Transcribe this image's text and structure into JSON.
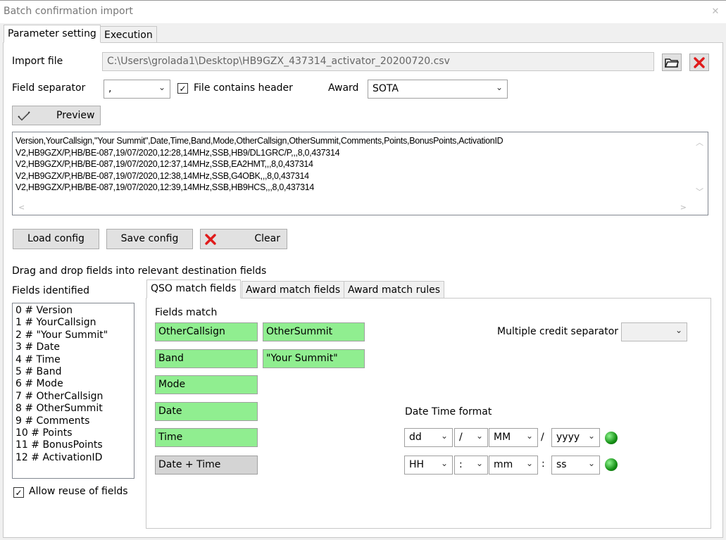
{
  "window": {
    "title": "Batch confirmation import",
    "close": "✕"
  },
  "tabs": [
    "Parameter setting",
    "Execution"
  ],
  "import_file": {
    "label": "Import file",
    "value": "C:\\Users\\grolada1\\Desktop\\HB9GZX_437314_activator_20200720.csv"
  },
  "field_separator": {
    "label": "Field separator",
    "value": ","
  },
  "header_checkbox": {
    "label": "File contains header",
    "checked": true
  },
  "award": {
    "label": "Award",
    "value": "SOTA"
  },
  "preview_button": {
    "label": "Preview"
  },
  "preview_lines": [
    "Version,YourCallsign,\"Your Summit\",Date,Time,Band,Mode,OtherCallsign,OtherSummit,Comments,Points,BonusPoints,ActivationID",
    "V2,HB9GZX/P,HB/BE-087,19/07/2020,12:28,14MHz,SSB,HB9/DL1GRC/P,,,8,0,437314",
    "V2,HB9GZX/P,HB/BE-087,19/07/2020,12:37,14MHz,SSB,EA2HMT,,,8,0,437314",
    "V2,HB9GZX/P,HB/BE-087,19/07/2020,12:38,14MHz,SSB,G4OBK,,,8,0,437314",
    "V2,HB9GZX/P,HB/BE-087,19/07/2020,12:39,14MHz,SSB,HB9HCS,,,8,0,437314"
  ],
  "config_buttons": {
    "load": "Load config",
    "save": "Save config",
    "clear": "Clear"
  },
  "drag_hint": "Drag and drop fields into relevant destination fields",
  "fields_identified": {
    "label": "Fields identified",
    "items": [
      "0 # Version",
      "1 # YourCallsign",
      "2 # \"Your Summit\"",
      "3 # Date",
      "4 # Time",
      "5 # Band",
      "6 # Mode",
      "7 # OtherCallsign",
      "8 # OtherSummit",
      "9 # Comments",
      "10 # Points",
      "11 # BonusPoints",
      "12 # ActivationID"
    ]
  },
  "allow_reuse": {
    "label": "Allow reuse of fields",
    "checked": true
  },
  "sub_tabs": [
    "QSO match fields",
    "Award match fields",
    "Award match rules"
  ],
  "fields_match": {
    "label": "Fields match",
    "left": [
      "OtherCallsign",
      "Band",
      "Mode",
      "Date",
      "Time",
      "Date + Time"
    ],
    "right": [
      "OtherSummit",
      "\"Your Summit\""
    ]
  },
  "multiple_credit_separator": {
    "label": "Multiple credit separator",
    "value": ""
  },
  "date_time_format": {
    "label": "Date Time format",
    "date": {
      "day": "dd",
      "sep1": "/",
      "month": "MM",
      "sep2": "/",
      "year": "yyyy"
    },
    "time": {
      "hour": "HH",
      "sep1": ":",
      "minute": "mm",
      "sep2": ":",
      "second": "ss"
    }
  },
  "colors": {
    "match_green": "#90ee90",
    "led_green": "#159015"
  }
}
